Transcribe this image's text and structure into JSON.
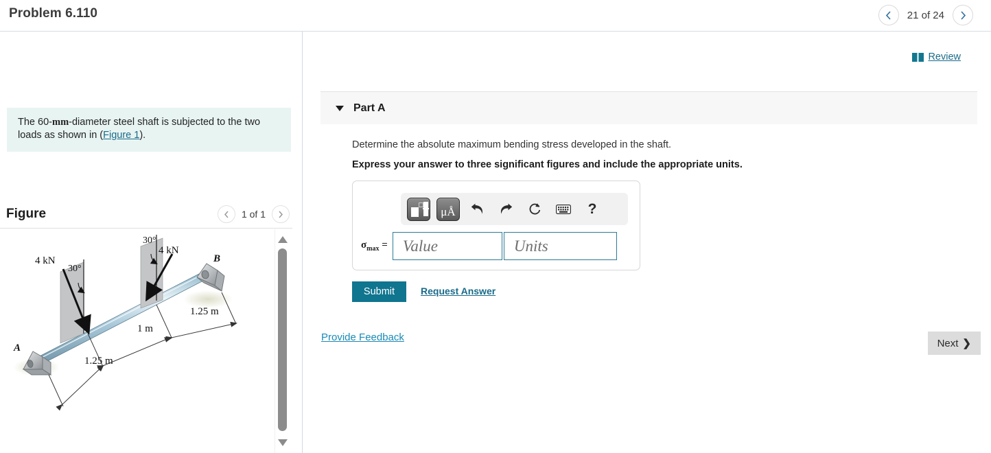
{
  "topbar": {
    "problem_title": "Problem 6.110",
    "prev_icon": "chevron-left-icon",
    "next_icon": "chevron-right-icon",
    "pager_label": "21 of 24"
  },
  "left": {
    "statement_prefix": "The 60-",
    "statement_unit": "mm",
    "statement_mid": "-diameter steel shaft is subjected to the two loads as shown in (",
    "statement_link": "Figure 1",
    "statement_suffix": ").",
    "figure_title": "Figure",
    "figure_pager_label": "1 of 1",
    "figure_prev_icon": "chevron-left-icon",
    "figure_next_icon": "chevron-right-icon",
    "scroll_up_icon": "triangle-up-icon",
    "scroll_down_icon": "triangle-down-icon"
  },
  "figure": {
    "label_a": "A",
    "label_b": "B",
    "load_left": "4 kN",
    "angle_left": "30°",
    "load_right": "4 kN",
    "angle_right": "30°",
    "dim_left": "1.25 m",
    "dim_mid": "1 m",
    "dim_right": "1.25 m"
  },
  "right": {
    "review_icon": "book-icon",
    "review_label": "Review",
    "part_caret_icon": "caret-down-icon",
    "part_label": "Part A",
    "question": "Determine the absolute maximum bending stress developed in the shaft.",
    "instruction": "Express your answer to three significant figures and include the appropriate units.",
    "toolbar": {
      "template_icon": "math-template-icon",
      "units_icon": "micro-angstrom-units-icon",
      "units_label": "μÅ",
      "undo_icon": "undo-arrow-icon",
      "redo_icon": "redo-arrow-icon",
      "reset_icon": "reset-circle-icon",
      "keyboard_icon": "keyboard-icon",
      "help_icon": "question-mark-icon",
      "help_label": "?"
    },
    "answer": {
      "variable_symbol": "σ",
      "variable_subscript": "max",
      "equals": "=",
      "value_placeholder": "Value",
      "value": "",
      "units_placeholder": "Units",
      "units": ""
    },
    "submit_label": "Submit",
    "request_answer_label": "Request Answer",
    "provide_feedback_label": "Provide Feedback",
    "next_label": "Next",
    "next_chevron": "❯"
  },
  "colors": {
    "accent_teal": "#10758f",
    "link_blue": "#1a6b8a",
    "statement_bg": "#e8f4f2",
    "part_header_bg": "#f7f7f7"
  }
}
